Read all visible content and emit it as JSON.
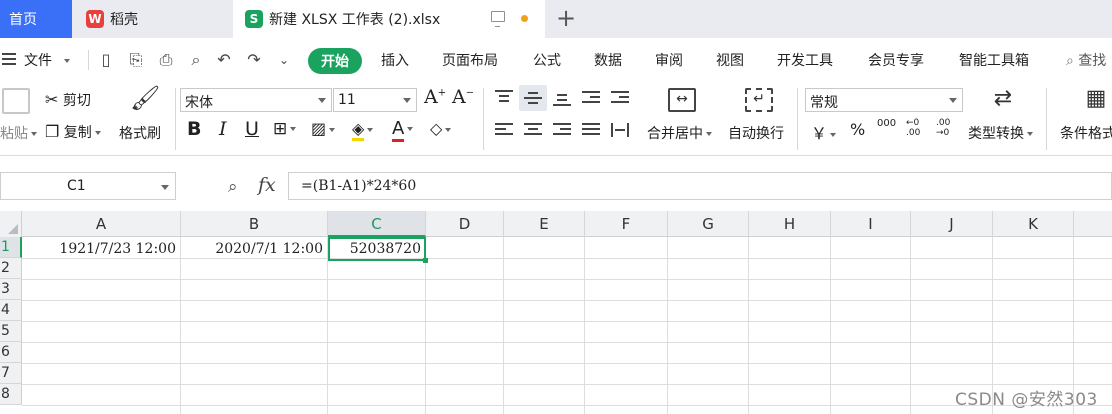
{
  "tabs": {
    "home": "首页",
    "daoke": "稻壳",
    "file": "新建 XLSX 工作表 (2).xlsx",
    "daoke_icon_glyph": "W",
    "file_icon_glyph": "S"
  },
  "menu": {
    "file": "文件",
    "start": "开始",
    "insert": "插入",
    "page_layout": "页面布局",
    "formulas": "公式",
    "data": "数据",
    "review": "审阅",
    "view": "视图",
    "developer": "开发工具",
    "member": "会员专享",
    "smart_toolbox": "智能工具箱",
    "search": "查找"
  },
  "ribbon": {
    "paste": "粘贴",
    "cut": "剪切",
    "copy": "复制",
    "format_painter": "格式刷",
    "font_name": "宋体",
    "font_size": "11",
    "bold": "B",
    "italic": "I",
    "underline": "U",
    "font_color_glyph": "A",
    "font_grow": "A",
    "font_shrink": "A",
    "merge_center": "合并居中",
    "wrap_text": "自动换行",
    "number_format": "常规",
    "currency": "￥",
    "percent": "%",
    "thousands": "000",
    "inc_decimal": "←0 .00",
    "dec_decimal": ".00 →0",
    "type_convert": "类型转换",
    "conditional_format": "条件格式"
  },
  "formula_bar": {
    "name_box": "C1",
    "fx": "fx",
    "formula": "=(B1-A1)*24*60"
  },
  "sheet": {
    "columns": [
      "A",
      "B",
      "C",
      "D",
      "E",
      "F",
      "G",
      "H",
      "I",
      "J",
      "K"
    ],
    "rows": [
      "1",
      "2",
      "3",
      "4",
      "5",
      "6",
      "7",
      "8"
    ],
    "cells": {
      "A1": "1921/7/23 12:00",
      "B1": "2020/7/1 12:00",
      "C1": "52038720"
    },
    "selected_cell": "C1"
  },
  "watermark": "CSDN @安然303",
  "colors": {
    "accent_green": "#1aa35f",
    "home_tab_blue": "#3a6ff7",
    "modified_dot": "#f0a020"
  }
}
